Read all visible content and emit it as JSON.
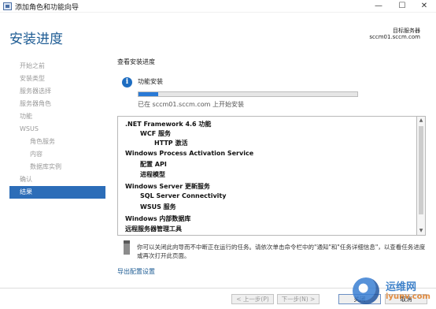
{
  "window": {
    "title": "添加角色和功能向导",
    "minimize": "—",
    "maximize": "☐",
    "close": "✕"
  },
  "header": {
    "page_title": "安装进度",
    "target_label": "目标服务器",
    "target_server": "sccm01.sccm.com"
  },
  "nav": {
    "items": [
      {
        "label": "开始之前"
      },
      {
        "label": "安装类型"
      },
      {
        "label": "服务器选择"
      },
      {
        "label": "服务器角色"
      },
      {
        "label": "功能"
      },
      {
        "label": "WSUS"
      },
      {
        "label": "角色服务"
      },
      {
        "label": "内容"
      },
      {
        "label": "数据库实例"
      },
      {
        "label": "确认"
      },
      {
        "label": "结果"
      }
    ]
  },
  "main": {
    "section_title": "查看安装进度",
    "progress_title": "功能安装",
    "progress_fraction": 0.09,
    "progress_status": "已在 sccm01.sccm.com 上开始安装",
    "results": [
      ".NET Framework 4.6 功能",
      "WCF 服务",
      "HTTP 激活",
      "Windows Process Activation Service",
      "配置 API",
      "进程模型",
      "Windows Server 更新服务",
      "SQL Server Connectivity",
      "WSUS 服务",
      "Windows 内部数据库",
      "远程服务器管理工具"
    ],
    "note": "你可以关闭此向导而不中断正在运行的任务。请依次单击命令栏中的\"通知\"和\"任务详细信息\"，以查看任务进度或再次打开此页面。",
    "export_link": "导出配置设置"
  },
  "footer": {
    "prev": "< 上一步(P)",
    "next": "下一步(N) >",
    "close": "关闭",
    "cancel": "取消"
  },
  "watermark": {
    "line1": "运维网",
    "line2": "iyunv.com"
  },
  "colors": {
    "accent": "#1e5c94",
    "nav_active": "#2c6db8",
    "progress_fill": "#2a7ad6"
  }
}
